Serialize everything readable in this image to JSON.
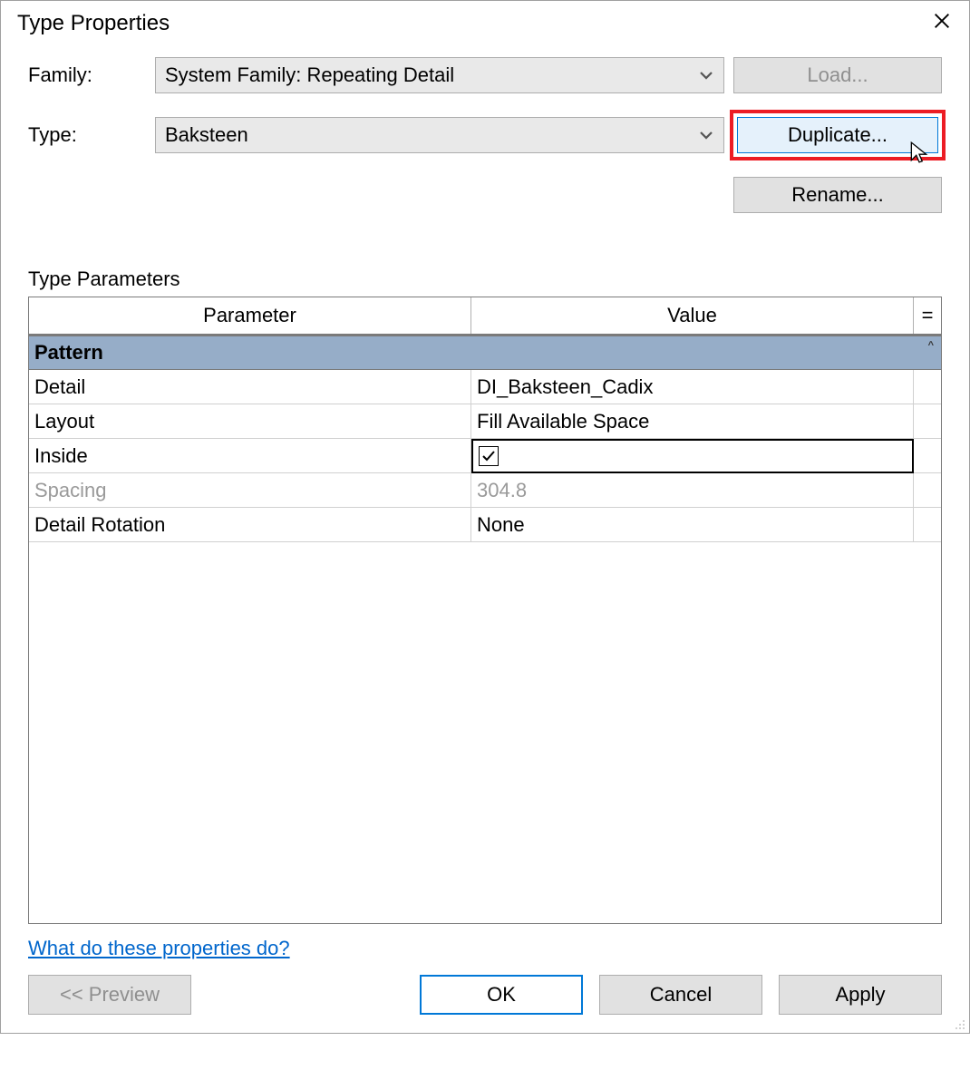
{
  "dialog": {
    "title": "Type Properties",
    "family_label": "Family:",
    "family_value": "System Family: Repeating Detail",
    "type_label": "Type:",
    "type_value": "Baksteen",
    "load_btn": "Load...",
    "duplicate_btn": "Duplicate...",
    "rename_btn": "Rename...",
    "type_parameters_label": "Type Parameters",
    "table": {
      "header_param": "Parameter",
      "header_value": "Value",
      "header_eq": "=",
      "group": "Pattern",
      "rows": [
        {
          "param": "Detail",
          "value": "DI_Baksteen_Cadix",
          "kind": "text",
          "disabled": false
        },
        {
          "param": "Layout",
          "value": "Fill Available Space",
          "kind": "text",
          "disabled": false
        },
        {
          "param": "Inside",
          "value": true,
          "kind": "check",
          "disabled": false,
          "focused": true
        },
        {
          "param": "Spacing",
          "value": "304.8",
          "kind": "text",
          "disabled": true
        },
        {
          "param": "Detail Rotation",
          "value": "None",
          "kind": "text",
          "disabled": false
        }
      ]
    },
    "help_link": "What do these properties do?",
    "footer": {
      "preview": "<<  Preview",
      "ok": "OK",
      "cancel": "Cancel",
      "apply": "Apply"
    }
  }
}
